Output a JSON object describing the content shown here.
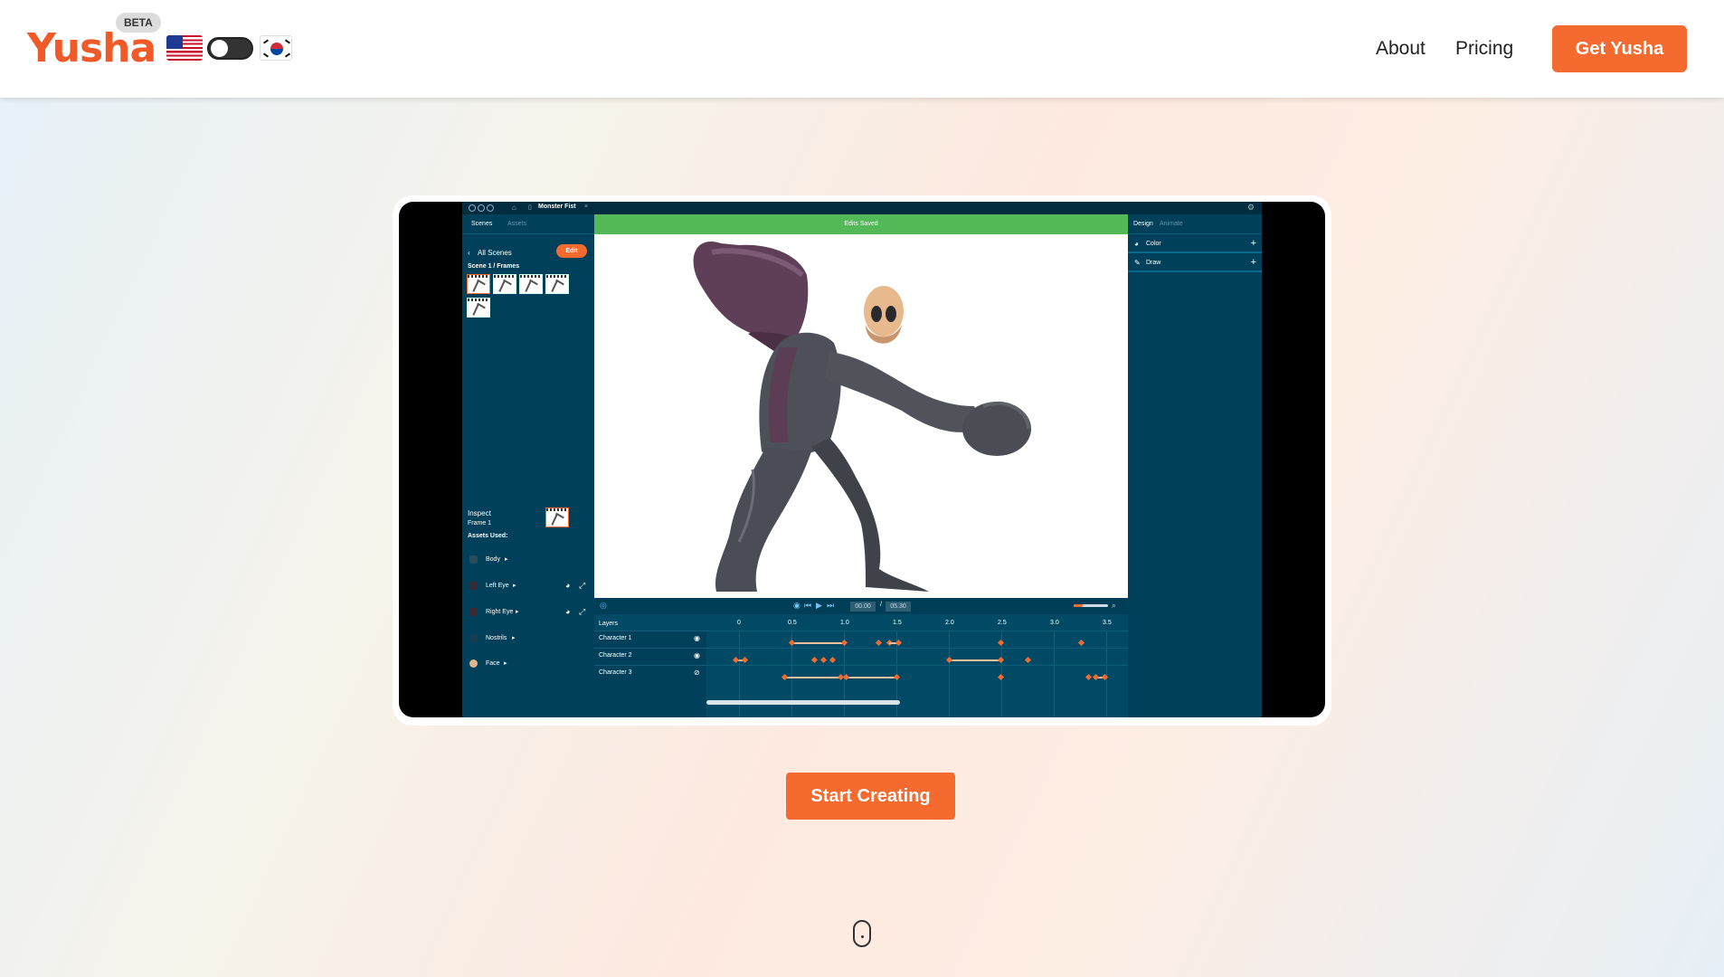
{
  "nav": {
    "logo": "Yusha",
    "beta": "BETA",
    "links": [
      "About",
      "Pricing"
    ],
    "cta": "Get Yusha"
  },
  "app": {
    "title": "Monster Fist",
    "left_tabs": [
      "Scenes",
      "Assets"
    ],
    "all_scenes": "All Scenes",
    "edit": "Edit",
    "breadcrumb": "Scene 1 / Frames",
    "inspect": "Inspect",
    "frame": "Frame 1",
    "assets_used": "Assets Used:",
    "assets": [
      "Body",
      "Left Eye",
      "Right Eye",
      "Nostrils",
      "Face"
    ],
    "status": "Edits Saved",
    "right_tabs": [
      "Design",
      "Animate"
    ],
    "right_items": [
      "Color",
      "Draw"
    ],
    "timeline": {
      "current": "00.00",
      "separator": "/",
      "total": "05.30",
      "layers_label": "Layers",
      "ruler": [
        "0",
        "0.5",
        "1.0",
        "1.5",
        "2.0",
        "2.5",
        "3.0",
        "3.5"
      ],
      "layers": [
        "Character 1",
        "Character 2",
        "Character 3"
      ]
    }
  },
  "hero": {
    "cta": "Start Creating"
  },
  "colors": {
    "brand": "#f05a28",
    "button": "#f56a2f",
    "app_bg": "#003349",
    "saved_bar": "#53b858"
  }
}
